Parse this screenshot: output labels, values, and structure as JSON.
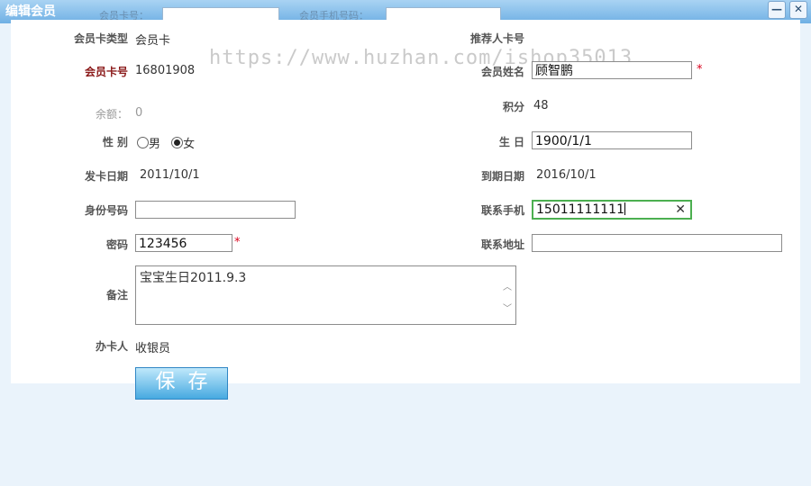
{
  "window": {
    "title": "编辑会员",
    "bg_label_card": "会员卡号：",
    "bg_label_phone": "会员手机号码：",
    "min_label": "—",
    "close_label": "✕"
  },
  "watermark": "https://www.huzhan.com/ishop35013",
  "form": {
    "card_type_label": "会员卡类型",
    "card_type_value": "会员卡",
    "referrer_label": "推荐人卡号",
    "card_no_label": "会员卡号",
    "card_no_value": "16801908",
    "name_label": "会员姓名",
    "name_value": "顾智鹏",
    "balance_label": "余额：",
    "balance_value": "0",
    "points_label": "积分",
    "points_value": "48",
    "gender_label": "性 别",
    "gender_male": "男",
    "gender_female": "女",
    "birthday_label": "生 日",
    "birthday_value": "1900/1/1",
    "issue_date_label": "发卡日期",
    "issue_date_value": "2011/10/1",
    "expire_label": "到期日期",
    "expire_value": "2016/10/1",
    "id_label": "身份号码",
    "id_value": "",
    "mobile_label": "联系手机",
    "mobile_value": "15011111111",
    "password_label": "密码",
    "password_value": "123456",
    "address_label": "联系地址",
    "address_value": "",
    "remark_label": "备注",
    "remark_value": "宝宝生日2011.9.3",
    "handler_label": "办卡人",
    "handler_value": "收银员",
    "required_mark": "*",
    "save_label": "保存"
  },
  "colors": {
    "accent": "#47a9e0",
    "required": "#d9001b",
    "focus": "#4caf50"
  }
}
